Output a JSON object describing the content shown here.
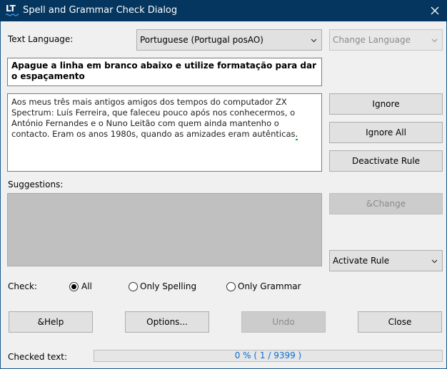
{
  "window": {
    "title": "Spell and Grammar Check Dialog",
    "logo_text": "LT"
  },
  "language": {
    "label": "Text Language:",
    "selected": "Portuguese (Portugal posAO)",
    "change_button": "Change Language"
  },
  "message": {
    "text": "Apague a linha em branco abaixo e utilize formatação para dar o espaçamento"
  },
  "sentence": {
    "text": "Aos meus três mais antigos amigos dos tempos do computador ZX Spectrum: Luís Ferreira, que faleceu pouco após nos conhecermos, o António Fernandes e o Nuno Leitão com quem ainda mantenho o contacto. Eram os anos 1980s, quando as amizades eram autênticas",
    "error_text": "."
  },
  "buttons": {
    "ignore": "Ignore",
    "ignore_all": "Ignore All",
    "deactivate_rule": "Deactivate Rule",
    "change": "&Change",
    "help": "&Help",
    "options": "Options...",
    "undo": "Undo",
    "close": "Close"
  },
  "suggestions": {
    "label": "Suggestions:"
  },
  "activate_rule": {
    "selected": "Activate Rule"
  },
  "check": {
    "label": "Check:",
    "options": [
      "All",
      "Only Spelling",
      "Only Grammar"
    ],
    "selected": "All"
  },
  "progress": {
    "label": "Checked text:",
    "text": "0 % ( 1 / 9399 )",
    "fraction": 0.0
  },
  "colors": {
    "titlebar": "#04365f",
    "error_underline": "#1db01d",
    "progress_text": "#0a6fd1"
  }
}
